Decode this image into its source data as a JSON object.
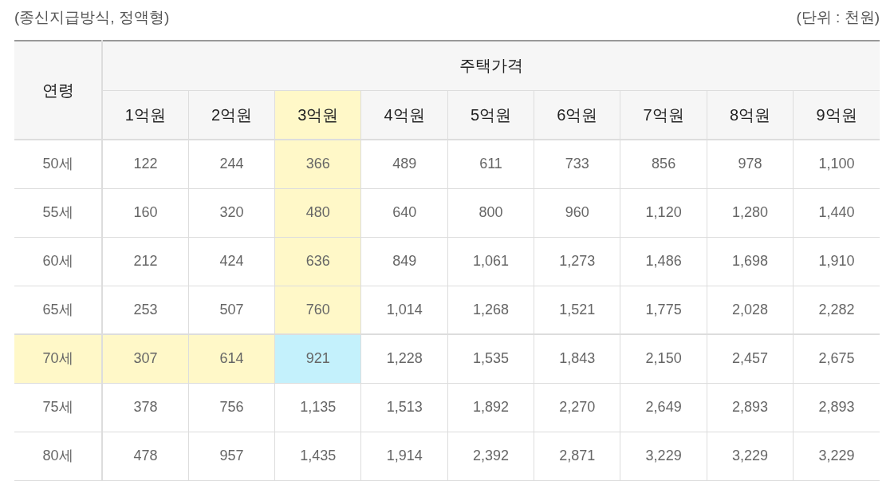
{
  "caption": "(종신지급방식, 정액형)",
  "unit": "(단위 : 천원)",
  "table": {
    "row_header": "연령",
    "group_header": "주택가격",
    "columns": [
      {
        "label": "1억원",
        "selected": false
      },
      {
        "label": "2억원",
        "selected": false
      },
      {
        "label": "3억원",
        "selected": true
      },
      {
        "label": "4억원",
        "selected": false
      },
      {
        "label": "5억원",
        "selected": false
      },
      {
        "label": "6억원",
        "selected": false
      },
      {
        "label": "7억원",
        "selected": false
      },
      {
        "label": "8억원",
        "selected": false
      },
      {
        "label": "9억원",
        "selected": false
      }
    ],
    "rows": [
      {
        "age": "50세",
        "selected": false,
        "cells": [
          "122",
          "244",
          "366",
          "489",
          "611",
          "733",
          "856",
          "978",
          "1,100"
        ]
      },
      {
        "age": "55세",
        "selected": false,
        "cells": [
          "160",
          "320",
          "480",
          "640",
          "800",
          "960",
          "1,120",
          "1,280",
          "1,440"
        ]
      },
      {
        "age": "60세",
        "selected": false,
        "cells": [
          "212",
          "424",
          "636",
          "849",
          "1,061",
          "1,273",
          "1,486",
          "1,698",
          "1,910"
        ]
      },
      {
        "age": "65세",
        "selected": false,
        "cells": [
          "253",
          "507",
          "760",
          "1,014",
          "1,268",
          "1,521",
          "1,775",
          "2,028",
          "2,282"
        ]
      },
      {
        "age": "70세",
        "selected": true,
        "cells": [
          "307",
          "614",
          "921",
          "1,228",
          "1,535",
          "1,843",
          "2,150",
          "2,457",
          "2,675"
        ]
      },
      {
        "age": "75세",
        "selected": false,
        "cells": [
          "378",
          "756",
          "1,135",
          "1,513",
          "1,892",
          "2,270",
          "2,649",
          "2,893",
          "2,893"
        ]
      },
      {
        "age": "80세",
        "selected": false,
        "cells": [
          "478",
          "957",
          "1,435",
          "1,914",
          "2,392",
          "2,871",
          "3,229",
          "3,229",
          "3,229"
        ]
      }
    ]
  }
}
